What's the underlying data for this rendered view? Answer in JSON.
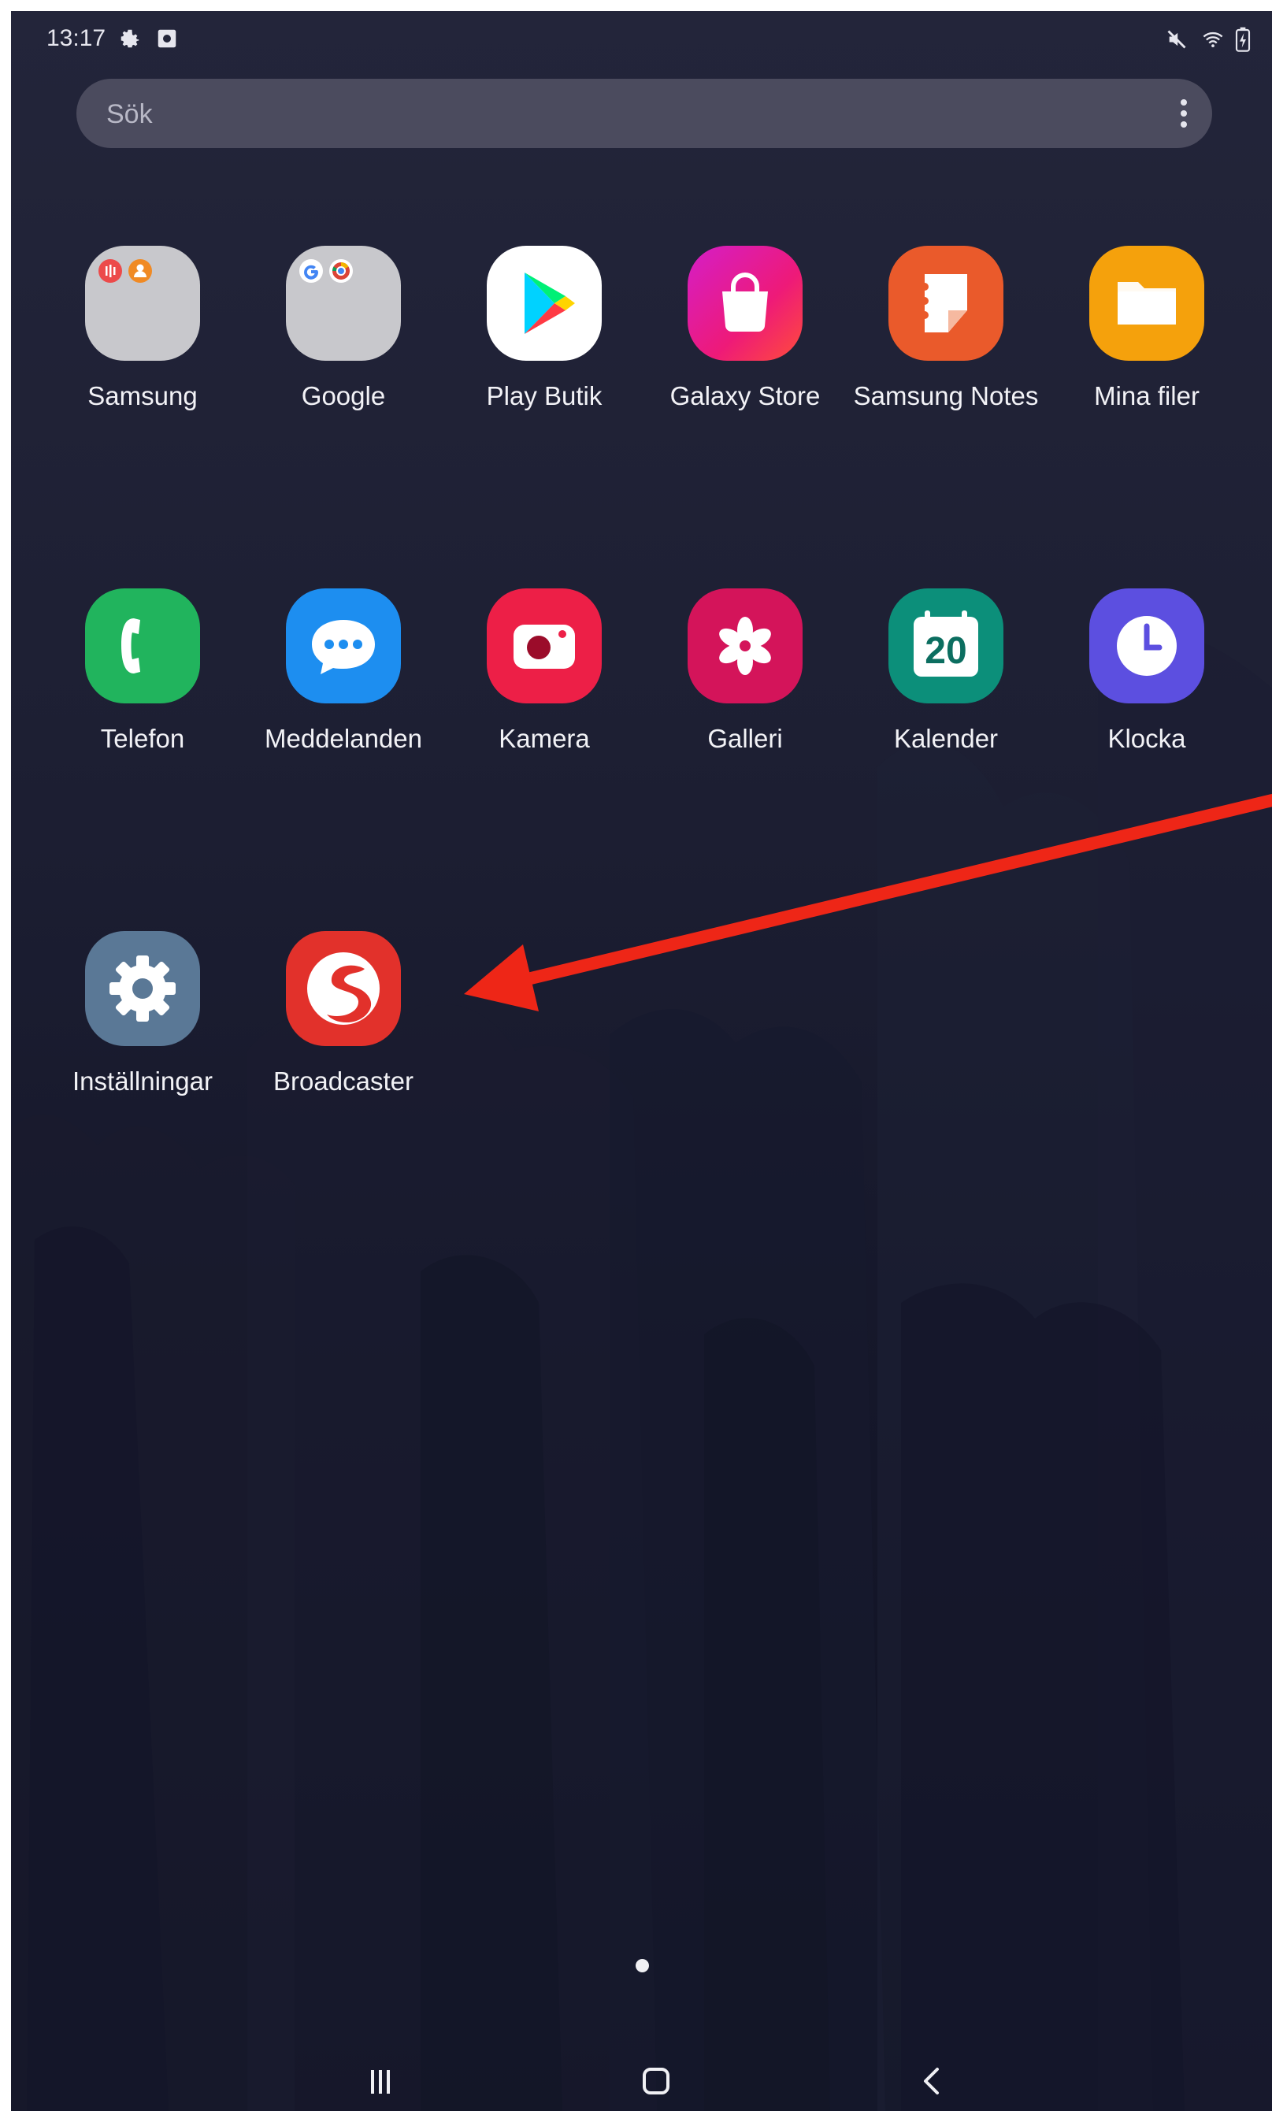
{
  "status_bar": {
    "time": "13:17",
    "icons_left": [
      "gear-icon",
      "screen-record-icon"
    ],
    "icons_right": [
      "mute-icon",
      "wifi-icon",
      "battery-charging-icon"
    ]
  },
  "search": {
    "placeholder": "Sök",
    "menu_icon": "more-vert-icon"
  },
  "apps": [
    {
      "label": "Samsung",
      "icon": "samsung-folder-icon",
      "color": "#c8c8cc"
    },
    {
      "label": "Google",
      "icon": "google-folder-icon",
      "color": "#c8c8cc"
    },
    {
      "label": "Play Butik",
      "icon": "play-store-icon",
      "color": "#ffffff"
    },
    {
      "label": "Galaxy Store",
      "icon": "galaxy-store-icon",
      "color": "#e5199a"
    },
    {
      "label": "Samsung Notes",
      "icon": "samsung-notes-icon",
      "color": "#ea5a2b"
    },
    {
      "label": "Mina filer",
      "icon": "folder-icon",
      "color": "#f5a10c"
    },
    {
      "label": "Telefon",
      "icon": "phone-icon",
      "color": "#21b45d"
    },
    {
      "label": "Meddelanden",
      "icon": "messages-icon",
      "color": "#1d8ef0"
    },
    {
      "label": "Kamera",
      "icon": "camera-icon",
      "color": "#ed1f47"
    },
    {
      "label": "Galleri",
      "icon": "gallery-flower-icon",
      "color": "#d4145a"
    },
    {
      "label": "Kalender",
      "icon": "calendar-icon",
      "color": "#0c8f7a",
      "day": "20"
    },
    {
      "label": "Klocka",
      "icon": "clock-icon",
      "color": "#5c4fe0"
    },
    {
      "label": "Inställningar",
      "icon": "settings-gear-icon",
      "color": "#5a7896"
    },
    {
      "label": "Broadcaster",
      "icon": "broadcaster-icon",
      "color": "#e2312b"
    }
  ],
  "annotation": {
    "type": "arrow",
    "color": "#ee2617",
    "points_to": "Broadcaster"
  },
  "pager": {
    "current_page": 1,
    "total_pages": 1
  },
  "nav_bar": [
    "recent-apps-icon",
    "home-icon",
    "back-icon"
  ]
}
